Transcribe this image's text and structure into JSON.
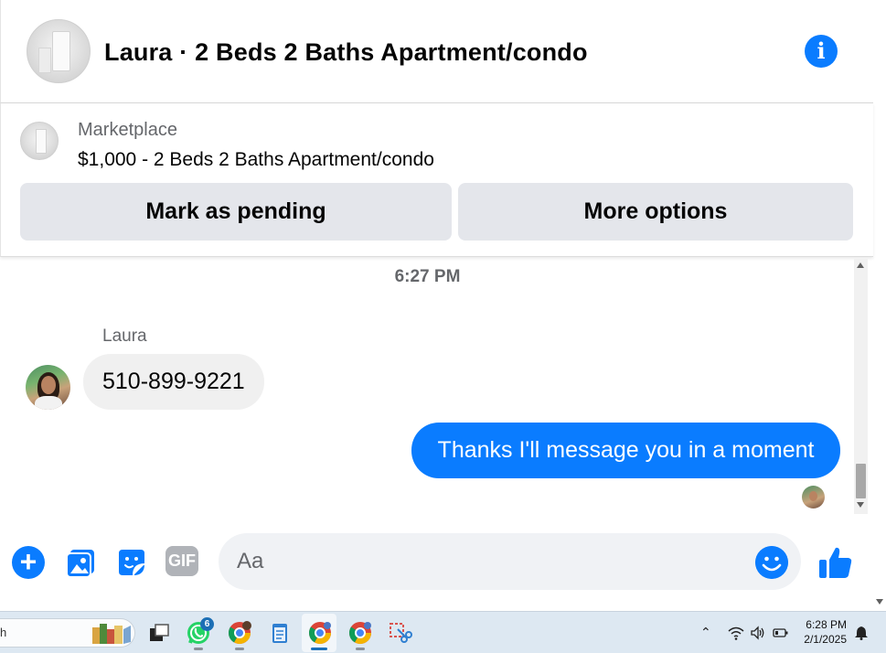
{
  "header": {
    "title": "Laura · 2 Beds 2 Baths Apartment/condo",
    "info_icon": "info-icon"
  },
  "listing": {
    "label": "Marketplace",
    "price_title": "$1,000 - 2 Beds 2 Baths Apartment/condo",
    "mark_pending_label": "Mark as pending",
    "more_options_label": "More options"
  },
  "conversation": {
    "timestamp": "6:27 PM",
    "sender_name": "Laura",
    "messages": [
      {
        "from": "Laura",
        "direction": "incoming",
        "text": "510-899-9221"
      },
      {
        "from": "me",
        "direction": "outgoing",
        "text": "Thanks I'll message you in a moment"
      }
    ]
  },
  "composer": {
    "placeholder": "Aa",
    "icons": [
      "plus-icon",
      "photo-icon",
      "sticker-icon",
      "gif-icon",
      "emoji-icon",
      "like-icon"
    ],
    "gif_label": "GIF"
  },
  "taskbar": {
    "search_text": "h",
    "whatsapp_badge": "6",
    "time": "6:28 PM",
    "date": "2/1/2025"
  },
  "colors": {
    "accent": "#0a7cff",
    "bubble_incoming": "#f0f0f0",
    "button_bg": "#e4e6eb",
    "secondary_text": "#65676b"
  }
}
